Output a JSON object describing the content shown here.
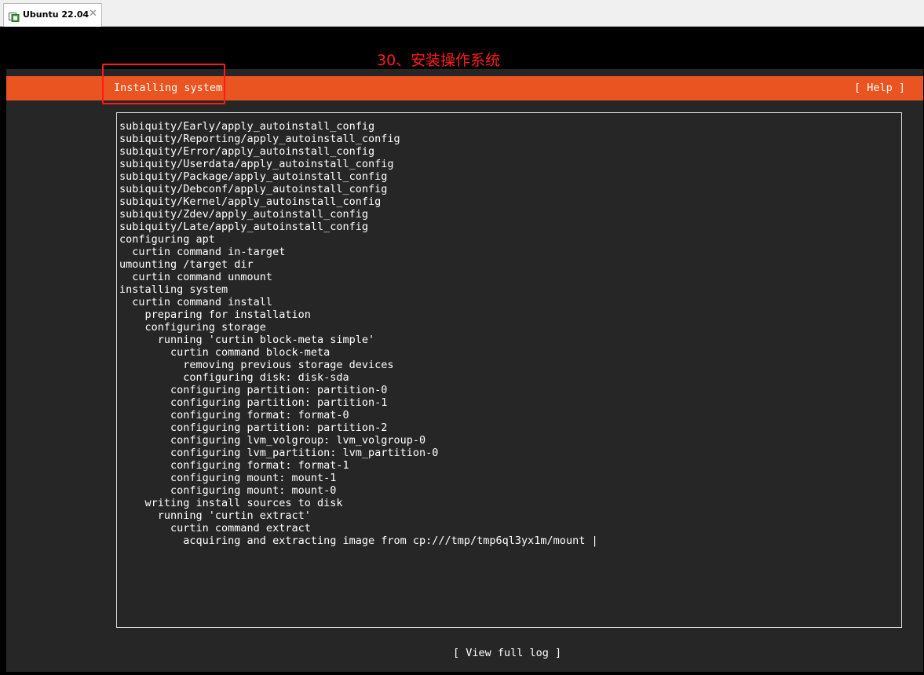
{
  "tab": {
    "title": "Ubuntu 22.04",
    "close_glyph": "✕",
    "icon": "vm-icon"
  },
  "annotation": {
    "text": "30、安装操作系统",
    "color": "#ff1b1b"
  },
  "header": {
    "title": "Installing system",
    "help_label": "[ Help ]",
    "accent_color": "#e95420"
  },
  "log": {
    "lines": [
      "subiquity/Early/apply_autoinstall_config",
      "subiquity/Reporting/apply_autoinstall_config",
      "subiquity/Error/apply_autoinstall_config",
      "subiquity/Userdata/apply_autoinstall_config",
      "subiquity/Package/apply_autoinstall_config",
      "subiquity/Debconf/apply_autoinstall_config",
      "subiquity/Kernel/apply_autoinstall_config",
      "subiquity/Zdev/apply_autoinstall_config",
      "subiquity/Late/apply_autoinstall_config",
      "configuring apt",
      "  curtin command in-target",
      "umounting /target dir",
      "  curtin command unmount",
      "installing system",
      "  curtin command install",
      "    preparing for installation",
      "    configuring storage",
      "      running 'curtin block-meta simple'",
      "        curtin command block-meta",
      "          removing previous storage devices",
      "          configuring disk: disk-sda",
      "        configuring partition: partition-0",
      "        configuring partition: partition-1",
      "        configuring format: format-0",
      "        configuring partition: partition-2",
      "        configuring lvm_volgroup: lvm_volgroup-0",
      "        configuring lvm_partition: lvm_partition-0",
      "        configuring format: format-1",
      "        configuring mount: mount-1",
      "        configuring mount: mount-0",
      "    writing install sources to disk",
      "      running 'curtin extract'",
      "        curtin command extract",
      "          acquiring and extracting image from cp:///tmp/tmp6ql3yx1m/mount |"
    ]
  },
  "footer": {
    "view_log_label": "[ View full log ]"
  }
}
